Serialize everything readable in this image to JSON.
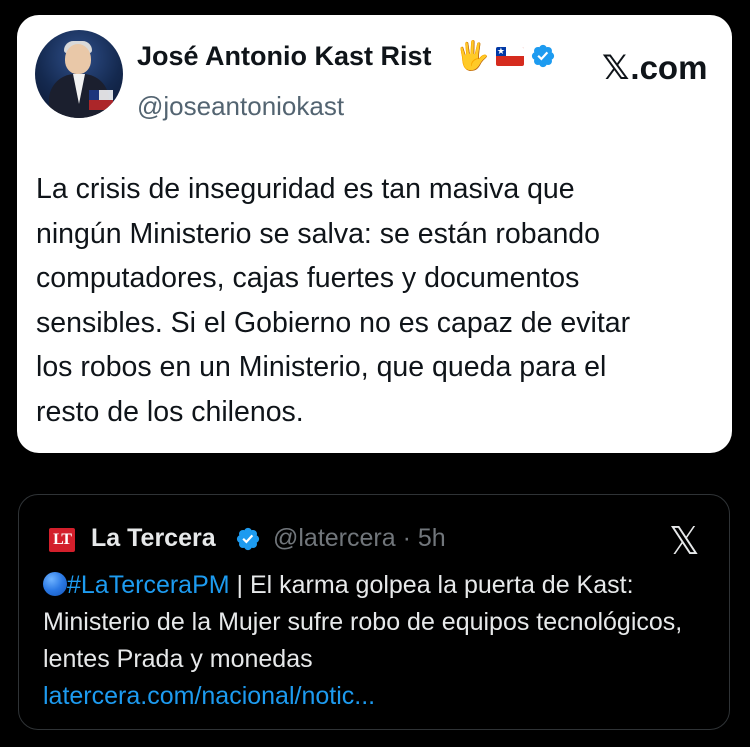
{
  "tweet": {
    "author_name": "José Antonio Kast Rist",
    "author_emoji": "🖐️",
    "handle": "@joseantoniokast",
    "site_label": ".com",
    "text": "La crisis de inseguridad es tan masiva que\nningún Ministerio se salva: se están robando\ncomputadores, cajas fuertes y documentos\nsensibles. Si el Gobierno no es capaz de evitar\nlos robos en un Ministerio, que queda para el\nresto de los chilenos."
  },
  "quoted": {
    "logo_text": "LT",
    "name": "La Tercera",
    "handle_time": "@latercera · 5h",
    "hashtag": "#LaTerceraPM",
    "text": " | El karma golpea la puerta de Kast: Ministerio de la Mujer sufre robo de equipos tecnológicos, lentes Prada y monedas",
    "link": "latercera.com/nacional/notic..."
  },
  "icons": {
    "verified": "verified-badge-icon",
    "flag": "chile-flag-icon",
    "x_logo": "x-logo-icon"
  },
  "colors": {
    "verified_blue": "#1d9bf0",
    "quote_border": "#2f3336",
    "link_blue": "#1d9bf0"
  }
}
